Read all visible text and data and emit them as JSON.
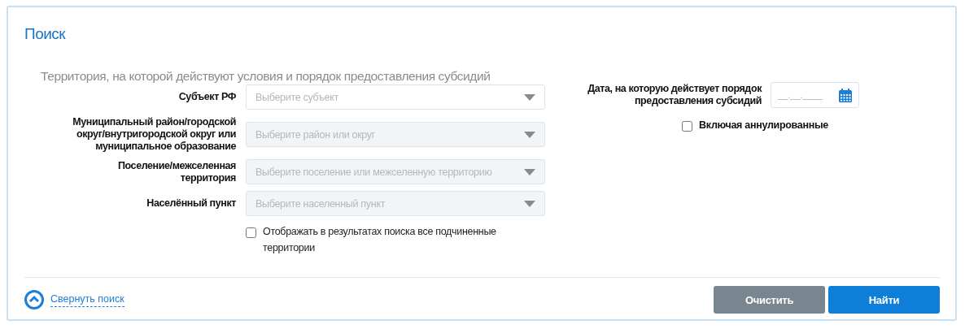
{
  "panel": {
    "title": "Поиск"
  },
  "territory": {
    "heading": "Территория, на которой действуют условия и порядок предоставления субсидий",
    "fields": [
      {
        "label": "Субъект РФ",
        "placeholder": "Выберите субъект",
        "disabled": false
      },
      {
        "label": "Муниципальный район/городской округ/внутригородской округ или муниципальное образование",
        "placeholder": "Выберите район или округ",
        "disabled": true
      },
      {
        "label": "Поселение/межселенная территория",
        "placeholder": "Выберите поселение или межселенную территорию",
        "disabled": true
      },
      {
        "label": "Населённый пункт",
        "placeholder": "Выберите населенный пункт",
        "disabled": true
      }
    ],
    "subordinate": {
      "label": "Отображать в результатах поиска все подчиненные территории",
      "checked": false
    }
  },
  "date": {
    "label": "Дата, на которую действует порядок предоставления субсидий",
    "placeholder": "__.__.____"
  },
  "annulled": {
    "label": "Включая аннулированные",
    "checked": false
  },
  "collapse_link": "Свернуть поиск",
  "buttons": [
    {
      "label": "Очистить",
      "kind": "secondary"
    },
    {
      "label": "Найти",
      "kind": "primary"
    }
  ]
}
